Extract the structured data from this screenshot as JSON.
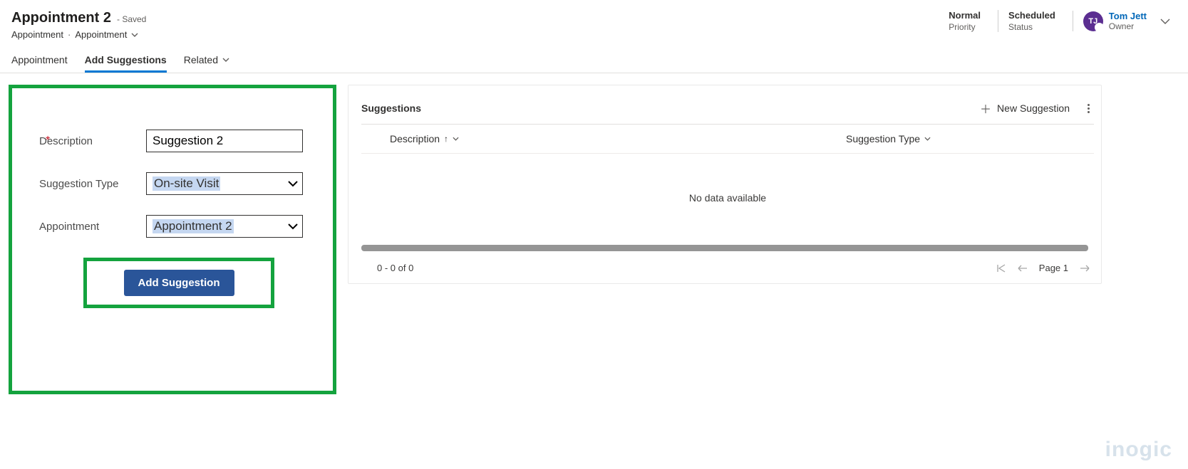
{
  "header": {
    "title": "Appointment 2",
    "saved_suffix": "- Saved",
    "breadcrumb": {
      "entity": "Appointment",
      "form": "Appointment"
    },
    "priority": {
      "value": "Normal",
      "label": "Priority"
    },
    "status": {
      "value": "Scheduled",
      "label": "Status"
    },
    "owner": {
      "initials": "TJ",
      "name": "Tom Jett",
      "label": "Owner"
    }
  },
  "tabs": {
    "appointment": "Appointment",
    "add_suggestions": "Add Suggestions",
    "related": "Related"
  },
  "form": {
    "description_label": "Description",
    "description_value": "Suggestion 2",
    "suggestion_type_label": "Suggestion Type",
    "suggestion_type_value": "On-site Visit",
    "appointment_label": "Appointment",
    "appointment_value": "Appointment 2",
    "add_button": "Add Suggestion"
  },
  "grid": {
    "title": "Suggestions",
    "new_button": "New Suggestion",
    "col_description": "Description",
    "col_type": "Suggestion Type",
    "empty_text": "No data available",
    "count_text": "0 - 0 of 0",
    "page_label": "Page 1"
  },
  "watermark": "inogic"
}
